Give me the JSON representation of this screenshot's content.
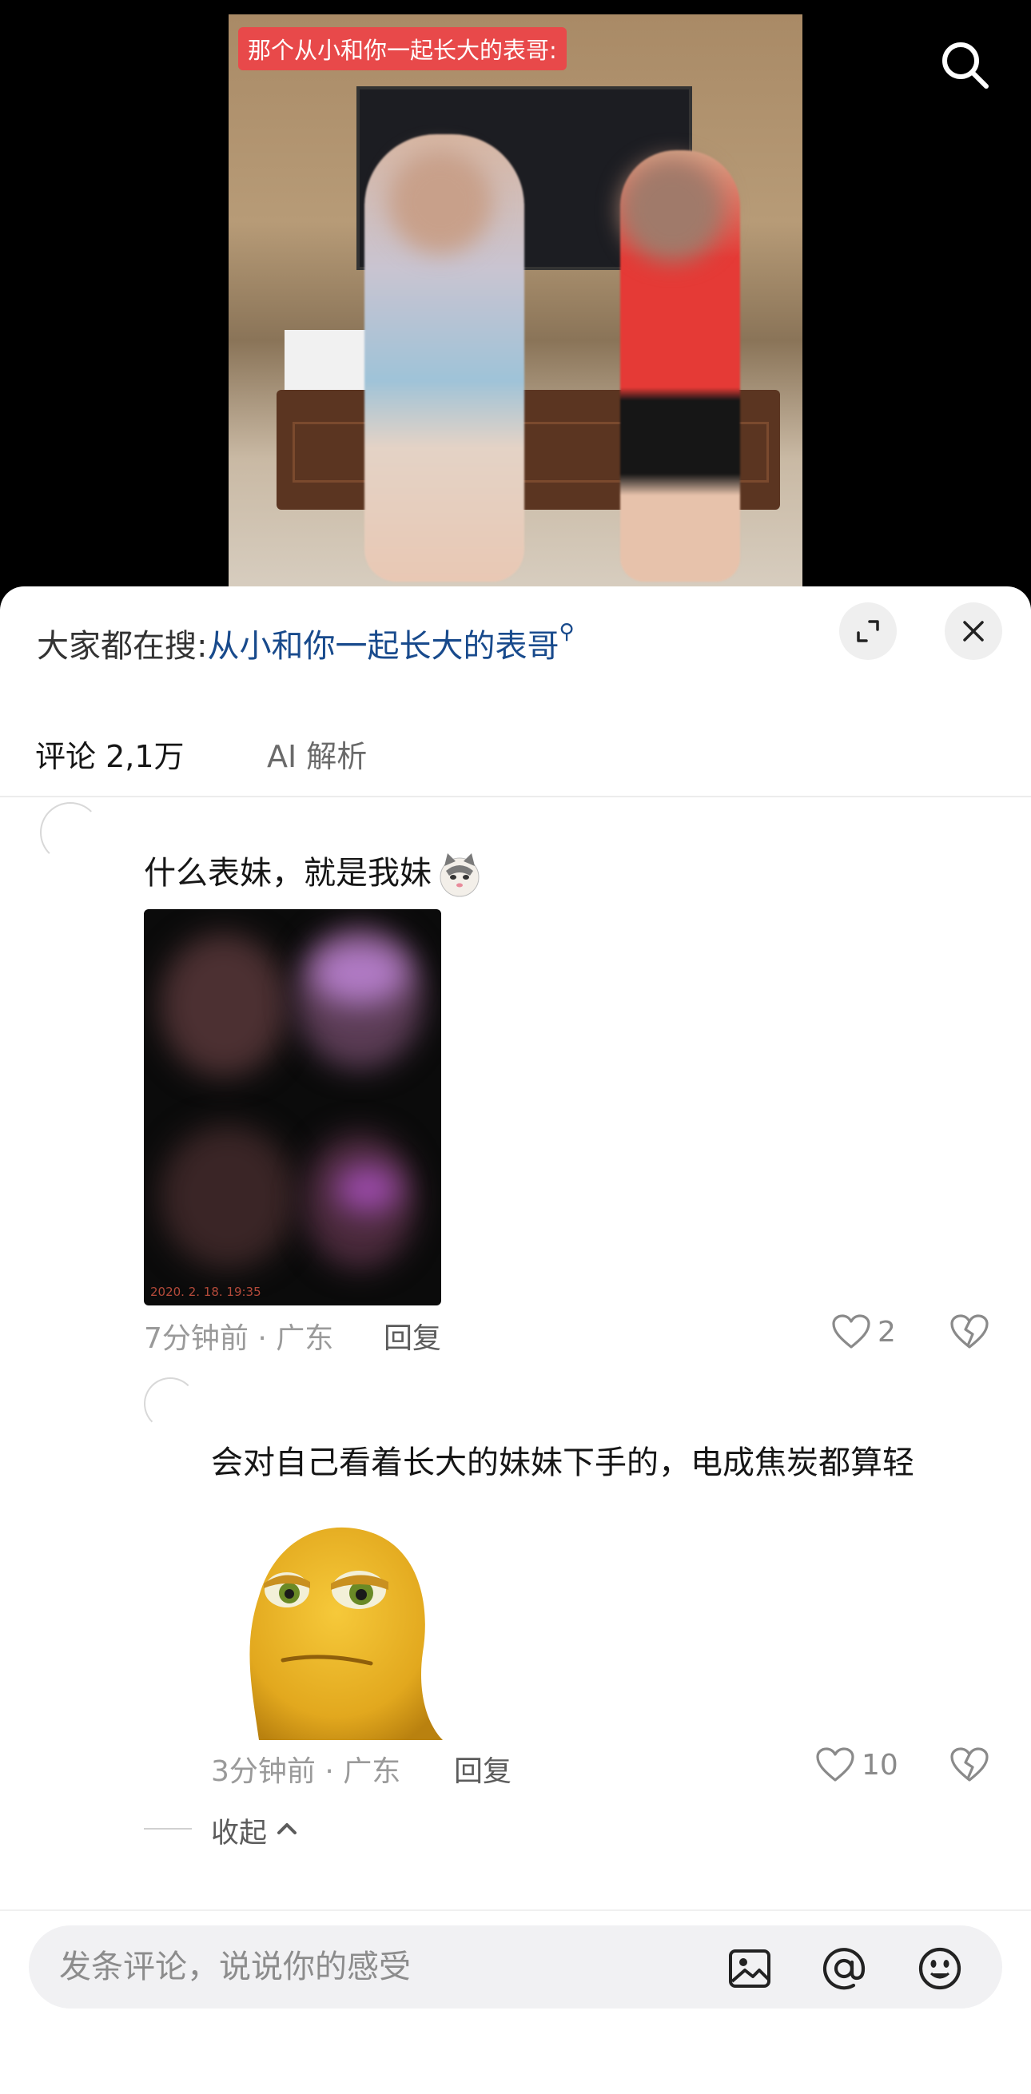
{
  "video": {
    "caption": "那个从小和你一起长大的表哥:"
  },
  "panel": {
    "search_prefix": "大家都在搜:",
    "search_term": "从小和你一起长大的表哥",
    "tabs": [
      {
        "label": "评论 2,1万"
      },
      {
        "label": "AI 解析"
      }
    ]
  },
  "comments": [
    {
      "text": "什么表妹，就是我妹",
      "image_stamp": "2020. 2. 18. 19:35",
      "meta": "7分钟前 · 广东",
      "reply_label": "回复",
      "likes": "2"
    },
    {
      "text": "会对自己看着长大的妹妹下手的，电成焦炭都算轻",
      "meta": "3分钟前 · 广东",
      "reply_label": "回复",
      "likes": "10"
    }
  ],
  "collapse_label": "收起",
  "input": {
    "placeholder": "发条评论，说说你的感受"
  },
  "colors": {
    "link": "#184a8c",
    "caption_bg": "#e8494a"
  },
  "icons": [
    "search-icon",
    "expand-icon",
    "close-icon",
    "heart-icon",
    "broken-heart-icon",
    "chevron-up-icon",
    "image-icon",
    "at-icon",
    "emoji-icon"
  ]
}
